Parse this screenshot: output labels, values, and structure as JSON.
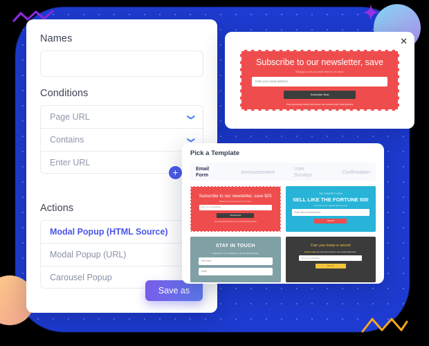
{
  "settings_panel": {
    "names": {
      "label": "Names",
      "value": "",
      "placeholder": ""
    },
    "conditions": {
      "label": "Conditions",
      "rows": [
        {
          "value": "Page URL",
          "icon": "chevron-down-icon"
        },
        {
          "value": "Contains",
          "icon": "chevron-down-icon"
        },
        {
          "value": "Enter URL",
          "icon": ""
        }
      ]
    },
    "add_button_label": "+",
    "actions": {
      "label": "Actions",
      "items": [
        {
          "label": "Modal Popup (HTML Source)",
          "selected": true
        },
        {
          "label": "Modal Popup (URL)",
          "selected": false
        },
        {
          "label": "Carousel Popup",
          "selected": false
        }
      ]
    },
    "save_label": "Save as"
  },
  "preview_panel": {
    "close_icon": "close-icon",
    "close_label": "✕",
    "newsletter": {
      "title": "Subscribe to our newsletter, save",
      "subtitle": "500apps is all you need free for 14 users",
      "input_placeholder": "Enter your email address",
      "button_label": "Subscribe Now",
      "note": "Your personal email will never be shared with third parties"
    }
  },
  "template_panel": {
    "heading": "Pick a Template",
    "tabs": [
      {
        "label": "Email Form",
        "active": true
      },
      {
        "label": "Announcement",
        "active": false
      },
      {
        "label": "User Surveys",
        "active": false
      },
      {
        "label": "Confirmation",
        "active": false
      }
    ],
    "templates": [
      {
        "id": "newsletter-red",
        "title": "Subscribe to our newsletter, save $25",
        "subtitle": "500apps is all you need free for 14 users",
        "input_placeholder": "Enter your email address",
        "button_label": "Subscribe Now",
        "note": "Your personal email will never be shared with third parties",
        "color": "#ef4d4d"
      },
      {
        "id": "fortune-blue",
        "kicker": "TRY 500APPS NOW",
        "title": "SELL LIKE THE FORTUNE 500",
        "subtitle": "From zero to one, upgrade when you grow",
        "input_placeholder": "Enter your email address",
        "button_label": "SIGN UP",
        "color": "#27b4d8"
      },
      {
        "id": "stay-in-touch",
        "title": "STAY IN TOUCH",
        "subtitle": "Subscribe to our newsletter to get the latest updates",
        "input_placeholder_1": "First name",
        "input_placeholder_2": "Email",
        "color": "#7fa0a5"
      },
      {
        "id": "secret-dark",
        "title": "Can you keep a secret",
        "subtitle_strong": "Secret sales",
        "subtitle_rest": " are only announced to our email subscribers.",
        "input_placeholder": "Enter your email address",
        "button_label": "SIGN UP",
        "color": "#3b3b3b"
      }
    ]
  },
  "decor": {
    "blob_color": "#1d3bd0",
    "star_color": "#9b30e0",
    "zigzag_purple_color": "#8a2be2",
    "zigzag_orange_color": "#f5a623",
    "sphere_colors": [
      "#7fd4f2",
      "#a98cf0"
    ],
    "circle_orange_colors": [
      "#ffc98a",
      "#f3a98f"
    ]
  }
}
